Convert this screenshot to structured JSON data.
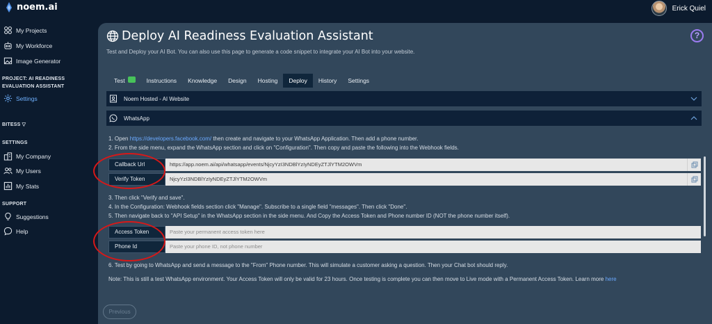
{
  "app": {
    "brand": "noem.ai",
    "user_name": "Erick Quiel"
  },
  "sidebar": {
    "items": [
      {
        "label": "My Projects",
        "icon": "projects-icon"
      },
      {
        "label": "My Workforce",
        "icon": "workforce-icon"
      },
      {
        "label": "Image Generator",
        "icon": "image-icon"
      }
    ],
    "project_heading": "PROJECT: AI READINESS EVALUATION ASSISTANT",
    "project_items": [
      {
        "label": "Settings",
        "icon": "gear-icon"
      }
    ],
    "bitess_heading": "BITESS",
    "settings_heading": "SETTINGS",
    "settings_items": [
      {
        "label": "My Company",
        "icon": "company-icon"
      },
      {
        "label": "My Users",
        "icon": "users-icon"
      },
      {
        "label": "My Stats",
        "icon": "stats-icon"
      }
    ],
    "support_heading": "SUPPORT",
    "support_items": [
      {
        "label": "Suggestions",
        "icon": "bulb-icon"
      },
      {
        "label": "Help",
        "icon": "help-chat-icon"
      }
    ]
  },
  "main": {
    "title": "Deploy AI Readiness Evaluation Assistant",
    "help_label": "?",
    "subtitle": "Test and Deploy your AI Bot. You can also use this page to generate a code snippet to integrate your AI Bot into your website.",
    "tabs": [
      {
        "label": "Test"
      },
      {
        "label": "Instructions"
      },
      {
        "label": "Knowledge"
      },
      {
        "label": "Design"
      },
      {
        "label": "Hosting"
      },
      {
        "label": "Deploy"
      },
      {
        "label": "History"
      },
      {
        "label": "Settings"
      }
    ],
    "active_tab": "Deploy",
    "accordions": [
      {
        "label": "Noem Hosted - AI Website",
        "expanded": false
      },
      {
        "label": "WhatsApp",
        "expanded": true
      }
    ],
    "whatsapp": {
      "step1_pre": "1. Open ",
      "step1_link": "https://developers.facebook.com/",
      "step1_post": " then create and navigate to your WhatsApp Application. Then add a phone number.",
      "step2": "2. From the side menu, expand the WhatsApp section and click on \"Configuration\". Then copy and paste the following into the Webhook fields.",
      "callback_label": "Callback Url",
      "callback_value": "https://app.noem.ai/api/whatsapp/events/NjcyYzI3NDBlYzIyNDEyZTJlYTM2OWVm",
      "verify_label": "Verify Token",
      "verify_value": "NjcyYzI3NDBlYzIyNDEyZTJlYTM2OWVm",
      "step3": "3. Then click \"Verify and save\".",
      "step4": "4. In the Configuration: Webhook fields section click \"Manage\". Subscribe to a single field \"messages\". Then click \"Done\".",
      "step5": "5. Then navigate back to \"API Setup\" in the WhatsApp section in the side menu. And Copy the Access Token and Phone number ID (NOT the phone number itself).",
      "access_label": "Access Token",
      "access_placeholder": "Paste your permanent access token here",
      "phone_label": "Phone Id",
      "phone_placeholder": "Paste your phone ID, not phone number",
      "step6": "6. Test by going to WhatsApp and send a message to the \"From\" Phone number. This will simulate a customer asking a question. Then your Chat bot should reply.",
      "note": "Note: This is still a test WhatsApp environment. Your Access Token will only be valid for 23 hours. Once testing is complete you can then move to Live mode with a Permanent Access Token. Learn more",
      "note_link": "here"
    },
    "previous_label": "Previous"
  },
  "colors": {
    "background": "#0c1b2e",
    "panel": "#32475b",
    "accent": "#6fb1ff",
    "annotation": "#d81818"
  }
}
